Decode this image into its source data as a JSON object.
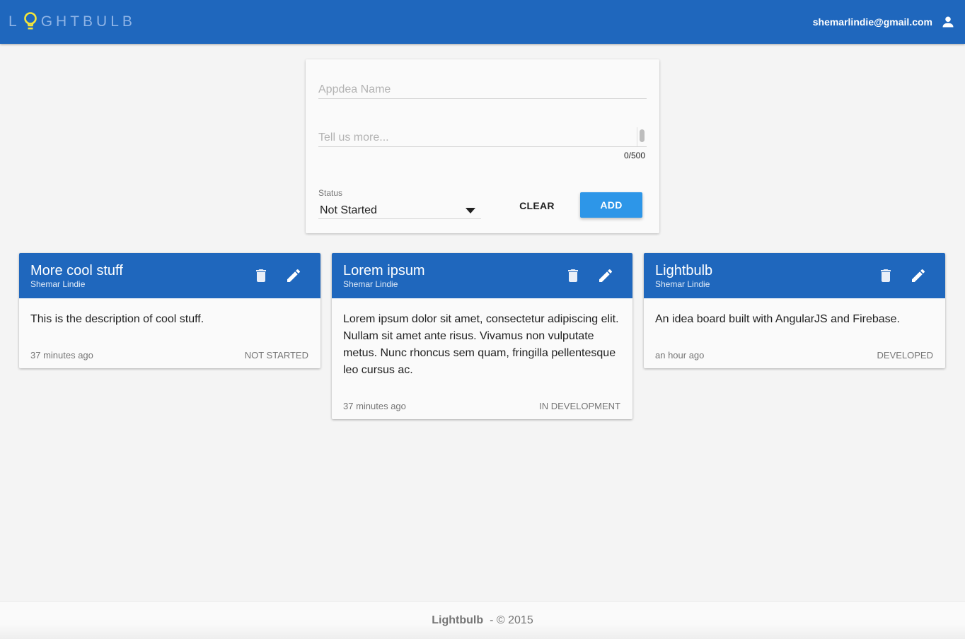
{
  "header": {
    "logo_text_pre": "L",
    "logo_text_post": "GHTBULB",
    "user_email": "shemarlindie@gmail.com",
    "colors": {
      "bar": "#1f67bd",
      "bulb": "#f5e63a"
    }
  },
  "form": {
    "name_placeholder": "Appdea Name",
    "name_value": "",
    "description_placeholder": "Tell us more...",
    "description_value": "",
    "char_counter": "0/500",
    "status_label": "Status",
    "status_selected": "Not Started",
    "clear_label": "CLEAR",
    "add_label": "ADD"
  },
  "cards": [
    {
      "title": "More cool stuff",
      "author": "Shemar Lindie",
      "description": "This is the description of cool stuff.",
      "time": "37 minutes ago",
      "status": "NOT STARTED"
    },
    {
      "title": "Lorem ipsum",
      "author": "Shemar Lindie",
      "description": "Lorem ipsum dolor sit amet, consectetur adipiscing elit. Nullam sit amet ante risus. Vivamus non vulputate metus. Nunc rhoncus sem quam, fringilla pellentesque leo cursus ac.",
      "time": "37 minutes ago",
      "status": "IN DEVELOPMENT"
    },
    {
      "title": "Lightbulb",
      "author": "Shemar Lindie",
      "description": "An idea board built with AngularJS and Firebase.",
      "time": "an hour ago",
      "status": "DEVELOPED"
    }
  ],
  "footer": {
    "brand": "Lightbulb",
    "copyright": "- © 2015"
  }
}
